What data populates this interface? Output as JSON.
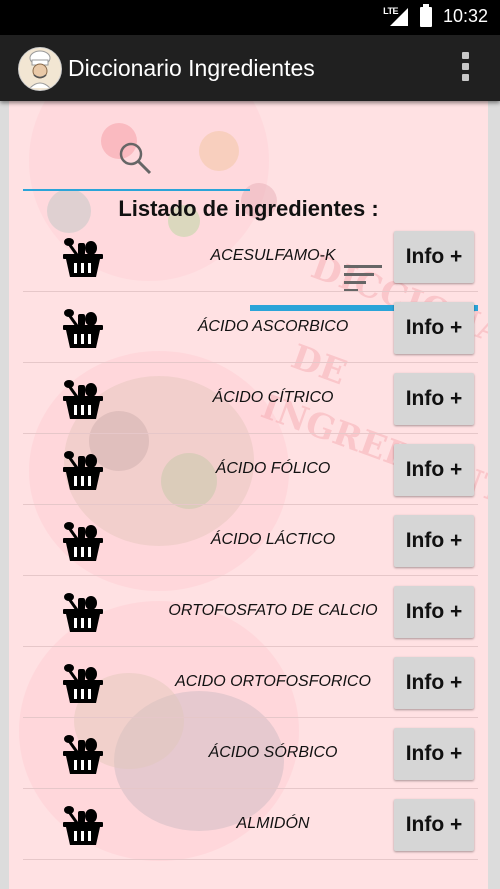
{
  "status_bar": {
    "network": "LTE",
    "time": "10:32"
  },
  "app_bar": {
    "title": "Diccionario Ingredientes",
    "logo_icon": "chef-logo",
    "menu_icon": "overflow-menu-icon"
  },
  "tabs": [
    {
      "icon": "search-icon",
      "selected": false
    },
    {
      "icon": "list-icon",
      "selected": true
    }
  ],
  "heading": "Listado de ingredientes :",
  "ingredients": [
    {
      "name": "ACESULFAMO-K",
      "button": "Info +"
    },
    {
      "name": "ÁCIDO ASCORBICO",
      "button": "Info +"
    },
    {
      "name": "ÁCIDO CÍTRICO",
      "button": "Info +"
    },
    {
      "name": "ÁCIDO FÓLICO",
      "button": "Info +"
    },
    {
      "name": "ÁCIDO LÁCTICO",
      "button": "Info +"
    },
    {
      "name": "ORTOFOSFATO DE CALCIO",
      "button": "Info +"
    },
    {
      "name": "ACIDO ORTOFOSFORICO",
      "button": "Info +"
    },
    {
      "name": "ÁCIDO SÓRBICO",
      "button": "Info +"
    },
    {
      "name": "ALMIDÓN",
      "button": "Info +"
    }
  ],
  "colors": {
    "accent": "#2ba4d8",
    "background": "#ffe1e3",
    "app_bar": "#202020",
    "button": "#d6d6d6"
  }
}
